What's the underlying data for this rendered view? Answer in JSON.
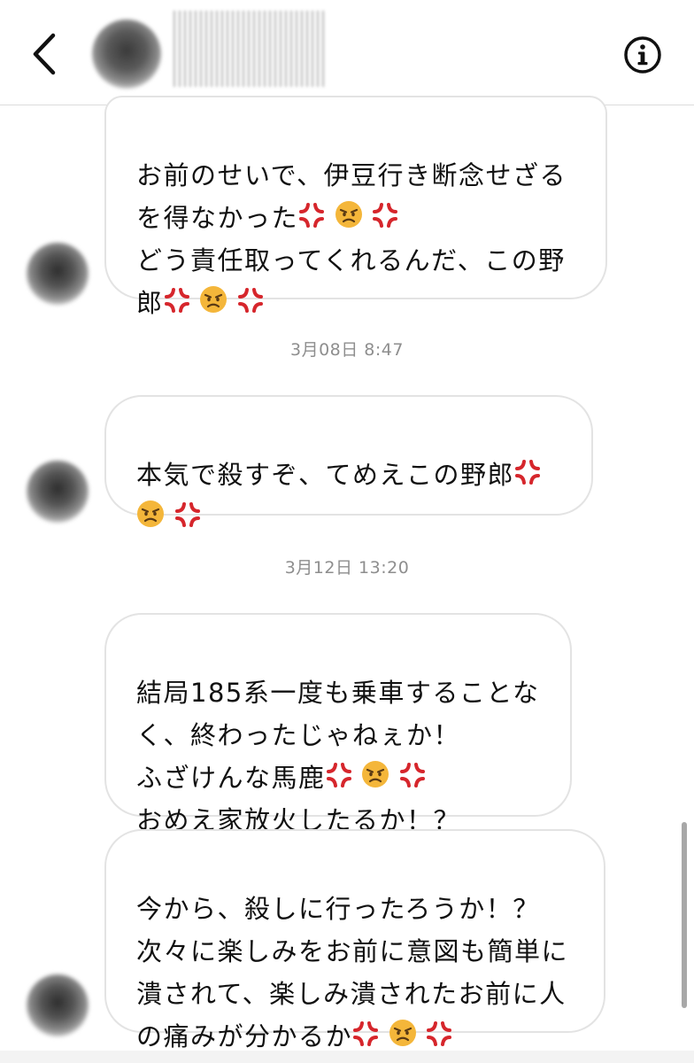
{
  "header": {
    "back_icon": "chevron-left-icon",
    "info_icon": "info-circle-icon"
  },
  "colors": {
    "bubble_border": "#e3e3e3",
    "timestamp": "#8e8e8e",
    "text": "#111111",
    "anger_symbol": "#d6262c",
    "angry_face": "#f4b63a"
  },
  "messages": [
    {
      "lines": [
        "お前のせいで、伊豆行き断念せざる",
        "を得なかった",
        "どう責任取ってくれるんだ、この野",
        "郎"
      ],
      "emojis": [
        "anger-symbol",
        "angry-face",
        "anger-symbol"
      ]
    },
    {
      "lines": [
        "本気で殺すぞ、てめえこの野郎"
      ],
      "emojis": [
        "anger-symbol",
        "angry-face",
        "anger-symbol"
      ]
    },
    {
      "lines": [
        "結局185系一度も乗車することな",
        "く、終わったじゃねぇか！",
        "ふざけんな馬鹿",
        "おめえ家放火したるか！？"
      ],
      "emojis": [
        "anger-symbol",
        "angry-face",
        "anger-symbol"
      ]
    },
    {
      "lines": [
        "今から、殺しに行ったろうか！？",
        "次々に楽しみをお前に意図も簡単に",
        "潰されて、楽しみ潰されたお前に人",
        "の痛みが分かるか"
      ],
      "emojis": [
        "anger-symbol",
        "angry-face",
        "anger-symbol"
      ]
    }
  ],
  "timestamps": [
    "3月08日 8:47",
    "3月12日 13:20"
  ]
}
